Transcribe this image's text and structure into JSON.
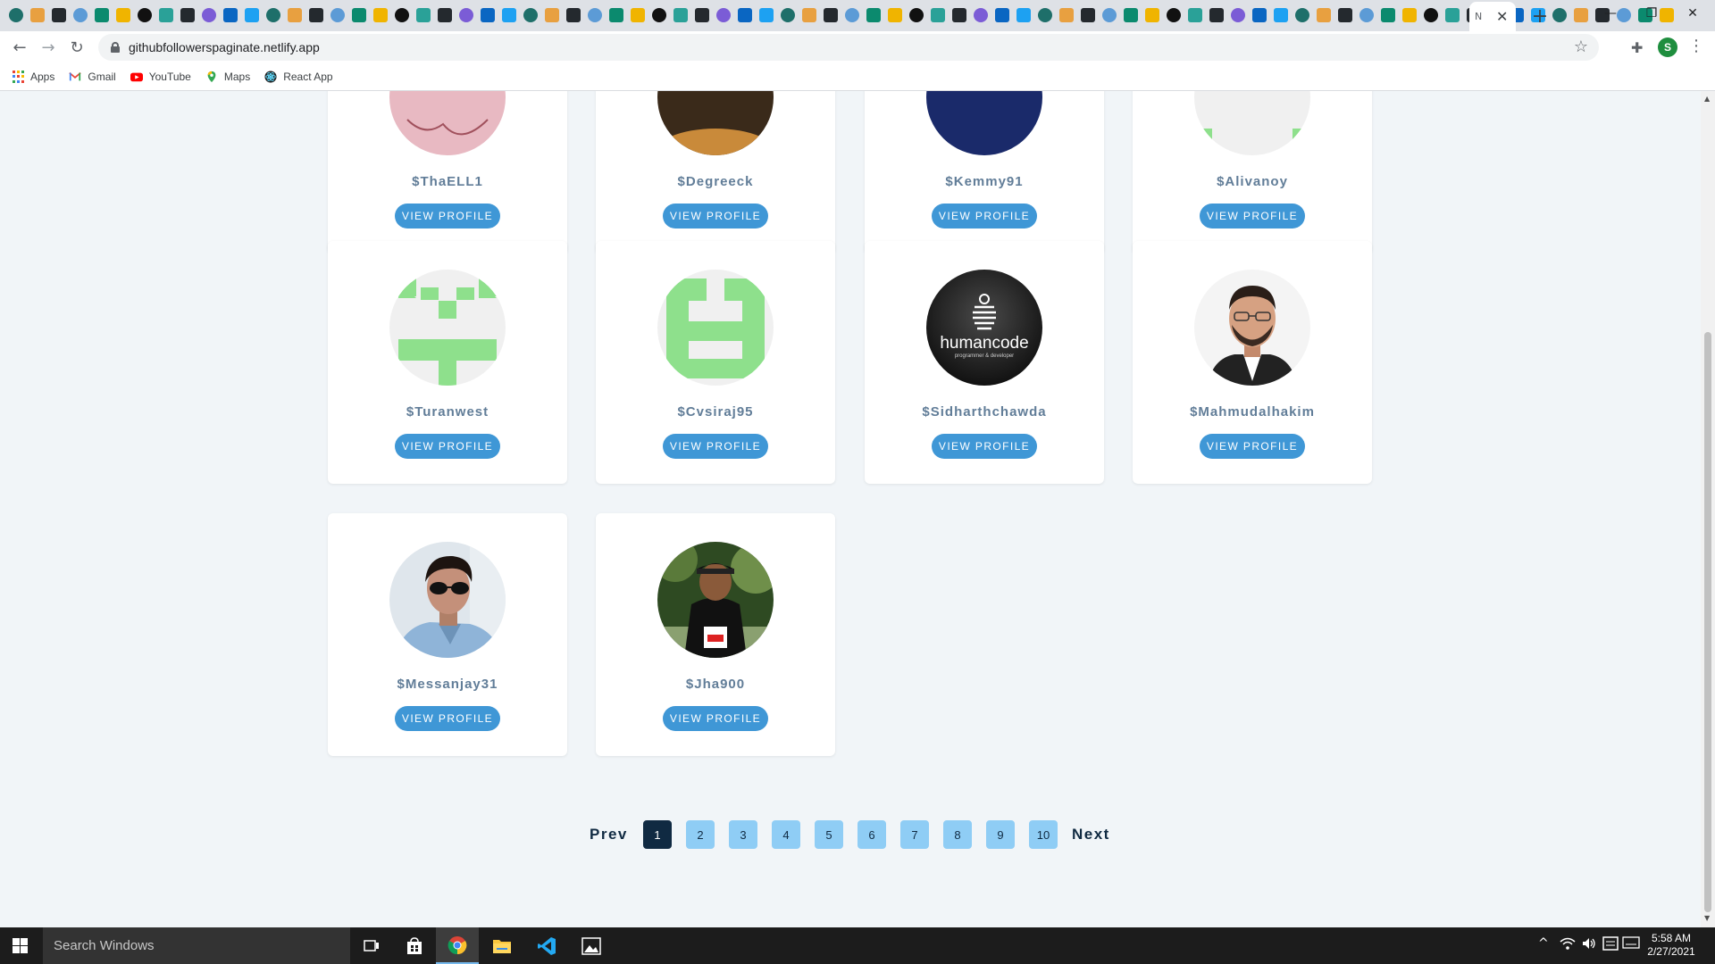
{
  "browser": {
    "active_tab_close": "✕",
    "new_tab": "+",
    "url": "githubfollowerspaginate.netlify.app",
    "profile_initial": "S"
  },
  "bookmarks": [
    {
      "label": "Apps",
      "icon": "apps-grid-icon"
    },
    {
      "label": "Gmail",
      "icon": "gmail-icon"
    },
    {
      "label": "YouTube",
      "icon": "youtube-icon"
    },
    {
      "label": "Maps",
      "icon": "maps-icon"
    },
    {
      "label": "React App",
      "icon": "react-icon"
    }
  ],
  "followers_partial": [
    {
      "login": "$ThaELL1",
      "button": "VIEW PROFILE"
    },
    {
      "login": "$Degreeck",
      "button": "VIEW PROFILE"
    },
    {
      "login": "$Kemmy91",
      "button": "VIEW PROFILE"
    },
    {
      "login": "$Alivanoy",
      "button": "VIEW PROFILE"
    }
  ],
  "followers": [
    {
      "login": "$Turanwest",
      "button": "VIEW PROFILE",
      "avatar": "identicon-green"
    },
    {
      "login": "$Cvsiraj95",
      "button": "VIEW PROFILE",
      "avatar": "identicon-green"
    },
    {
      "login": "$Sidharthchawda",
      "button": "VIEW PROFILE",
      "avatar": "humancode-logo",
      "avatar_text": "humancode",
      "avatar_subtext": "programmer & developer"
    },
    {
      "login": "$Mahmudalhakim",
      "button": "VIEW PROFILE",
      "avatar": "photo-man-glasses"
    },
    {
      "login": "$Messanjay31",
      "button": "VIEW PROFILE",
      "avatar": "photo-man-sunglasses"
    },
    {
      "login": "$Jha900",
      "button": "VIEW PROFILE",
      "avatar": "photo-runner"
    }
  ],
  "pagination": {
    "prev": "Prev",
    "next": "Next",
    "pages": [
      "1",
      "2",
      "3",
      "4",
      "5",
      "6",
      "7",
      "8",
      "9",
      "10"
    ],
    "active_page": "1"
  },
  "taskbar": {
    "search_placeholder": "Search Windows",
    "time": "5:58 AM",
    "date": "2/27/2021"
  },
  "colors": {
    "button_blue": "#3f97d6",
    "page_bg": "#f1f5f8",
    "pager_light": "#8fcdf5",
    "pager_dark": "#102a42",
    "identicon_green": "#8ee08c"
  }
}
